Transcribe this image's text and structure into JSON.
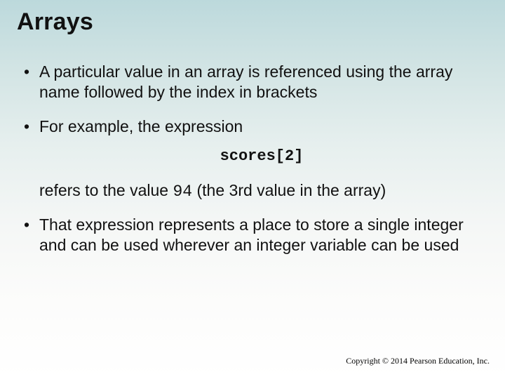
{
  "title": "Arrays",
  "bullets": {
    "b1": "A particular value in an array is referenced using the array name followed by the index in brackets",
    "b2": "For example, the expression",
    "code": "scores[2]",
    "cont_a": "refers to the value ",
    "cont_val": "94",
    "cont_b": " (the 3rd value in the array)",
    "b3": "That expression represents a place to store a single integer and can be used wherever an integer variable can be used"
  },
  "footer": "Copyright © 2014 Pearson Education, Inc."
}
